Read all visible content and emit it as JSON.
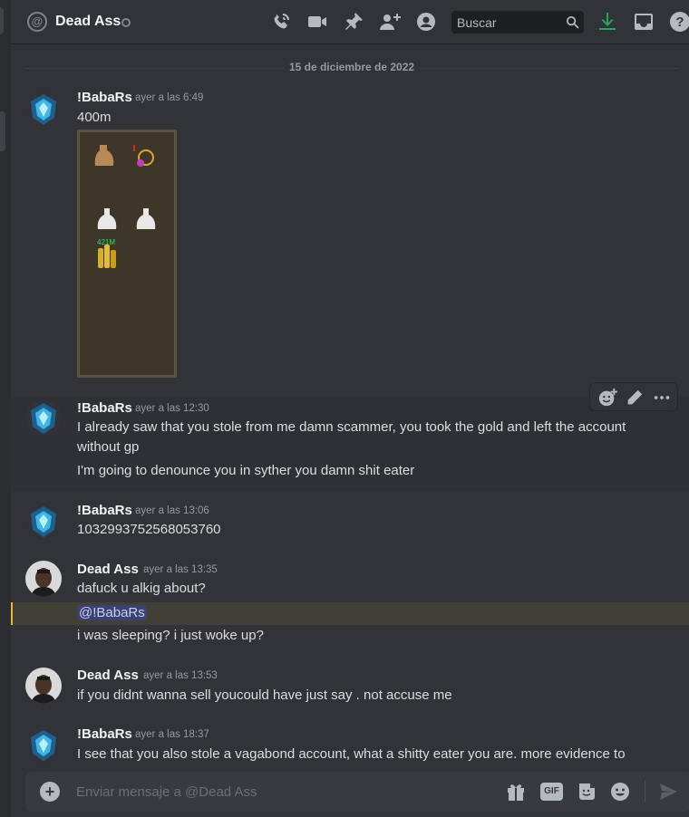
{
  "header": {
    "title": "Dead Ass",
    "search_placeholder": "Buscar"
  },
  "divider": "15 de diciembre de 2022",
  "messages": [
    {
      "user": "!BabaRs",
      "timestamp": "ayer a las 6:49",
      "lines": [
        "400m"
      ]
    },
    {
      "user": "!BabaRs",
      "timestamp": "ayer a las 12:30",
      "lines": [
        "I already saw that you stole from me damn scammer, you took the gold and left the account without gp",
        "I'm going to denounce you in syther you damn shit eater"
      ]
    },
    {
      "user": "!BabaRs",
      "timestamp": "ayer a las 13:06",
      "lines": [
        "1032993752568053760"
      ]
    },
    {
      "user": "Dead Ass",
      "timestamp": "ayer a las 13:35",
      "lines": [
        "dafuck u alkig about?",
        "@!BabaRs",
        "i was sleeping? i just woke up?"
      ]
    },
    {
      "user": "Dead Ass",
      "timestamp": "ayer a las 13:53",
      "lines": [
        "if you didnt wanna sell youcould have just say . not accuse me"
      ]
    },
    {
      "user": "!BabaRs",
      "timestamp": "ayer a las 18:37",
      "lines": [
        "I see that you also stole a vagabond account, what a shitty eater you are. more evidence to"
      ]
    }
  ],
  "attachment": {
    "coin_stack_label": "421M"
  },
  "composer": {
    "placeholder": "Enviar mensaje a @Dead Ass",
    "gif_label": "GIF"
  },
  "colors": {
    "background": "#313338",
    "mention": "#3c4270",
    "mention_highlight": "#f0b232",
    "download_icon": "#23a55a"
  }
}
